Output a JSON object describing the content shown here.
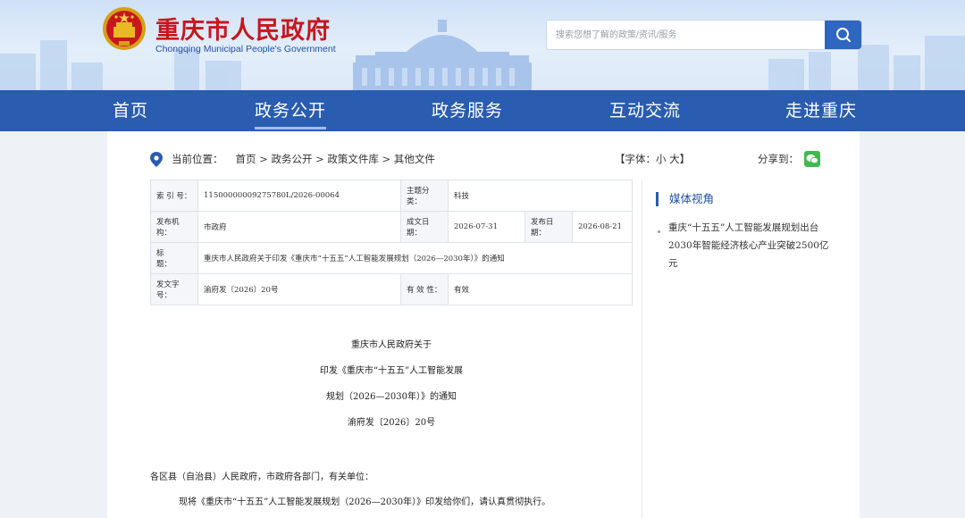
{
  "header": {
    "site_title": "重庆市人民政府",
    "site_subtitle": "Chongqing Municipal People's Government",
    "search_placeholder": "搜索您想了解的政策/资讯/服务"
  },
  "nav": {
    "items": [
      "首页",
      "政务公开",
      "政务服务",
      "互动交流",
      "走进重庆"
    ],
    "active": "政务公开"
  },
  "breadcrumb": {
    "label": "当前位置：",
    "path": "首页 > 政务公开 > 政策文件库 > 其他文件"
  },
  "font_control": {
    "prefix": "【字体：",
    "small": "小",
    "large": "大",
    "suffix": "】"
  },
  "share": {
    "label": "分享到："
  },
  "meta": {
    "index_label": "索 引 号：",
    "index_value": "11500000009275780L/2026-00064",
    "topic_label": "主题分类：",
    "topic_value": "科技",
    "issuer_label": "发布机构：",
    "issuer_value": "市政府",
    "written_label": "成文日期：",
    "written_value": "2026-07-31",
    "published_label": "发布日期：",
    "published_value": "2026-08-21",
    "title_label": "标　　题：",
    "title_value": "重庆市人民政府关于印发《重庆市“十五五”人工智能发展规划（2026—2030年）》的通知",
    "docno_label": "发文字号：",
    "docno_value": "渝府发〔2026〕20号",
    "validity_label": "有 效 性：",
    "validity_value": "有效"
  },
  "document": {
    "heading_lines": [
      "重庆市人民政府关于",
      "印发《重庆市“十五五”人工智能发展",
      "规划（2026—2030年）》的通知",
      "渝府发〔2026〕20号"
    ],
    "greeting": "各区县（自治县）人民政府，市政府各部门，有关单位：",
    "body": "现将《重庆市“十五五”人工智能发展规划（2026—2030年）》印发给你们，请认真贯彻执行。"
  },
  "sidebar": {
    "heading": "媒体视角",
    "items": [
      "重庆“十五五”人工智能发展规划出台 2030年智能经济核心产业突破2500亿元"
    ]
  },
  "colors": {
    "nav_bg": "#2a5cb0",
    "title_red": "#c8161d",
    "accent_blue": "#1f4fa3"
  }
}
